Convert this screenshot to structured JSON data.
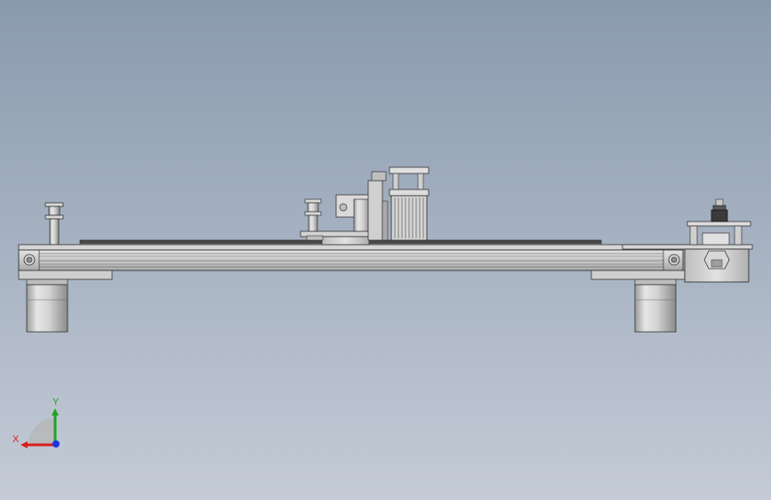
{
  "viewport": {
    "background_top": "#8a9aae",
    "background_bottom": "#c4cbd6"
  },
  "model": {
    "description_type": "CAD front view",
    "parts": [
      "left-roller-support",
      "main-aluminium-rail",
      "carriage-plate",
      "carriage-roller",
      "stepper-motor",
      "right-motor-mount",
      "left-foot",
      "right-foot"
    ]
  },
  "triad": {
    "x_label": "X",
    "y_label": "Y",
    "x_color": "#d81c1c",
    "y_color": "#1fa31f",
    "z_color": "#1a35e0"
  }
}
